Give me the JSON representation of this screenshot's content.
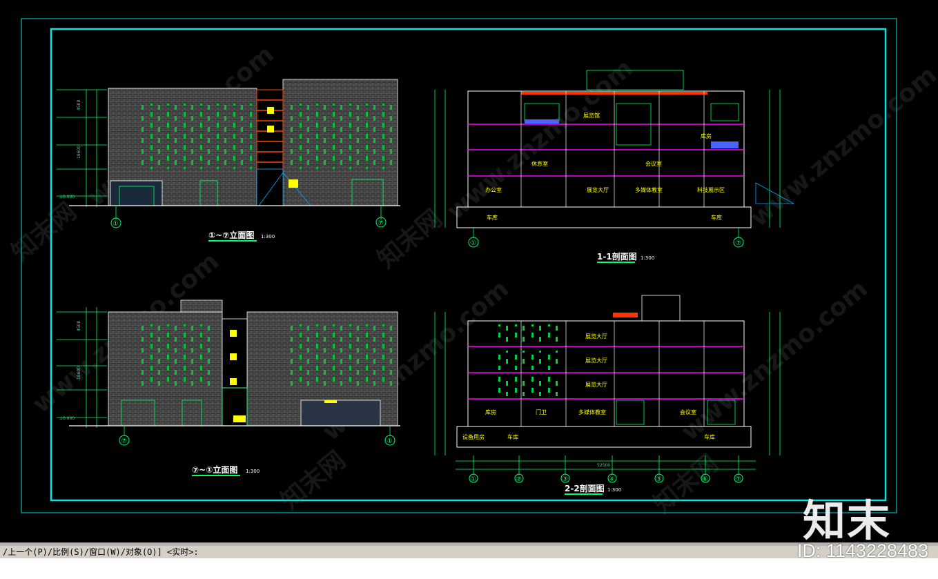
{
  "drawing": {
    "views": [
      {
        "title": "①~⑦立面图",
        "scale": "1:300"
      },
      {
        "title": "1-1剖面图",
        "scale": "1:300"
      },
      {
        "title": "⑦~①立面图",
        "scale": "1:300"
      },
      {
        "title": "2-2剖面图",
        "scale": "1:300"
      }
    ],
    "grid_labels": [
      "①",
      "⑦",
      "②",
      "③",
      "④",
      "⑤",
      "⑥"
    ],
    "room_labels": [
      "展览馆",
      "办公室",
      "车库",
      "展览大厅",
      "多媒体教室",
      "休息室",
      "会议室",
      "科技展示区",
      "库房",
      "门卫",
      "设备用房"
    ],
    "level_labels": [
      "±0.000",
      "-4.500",
      "5.100",
      "9.600",
      "14.100",
      "18.600",
      "23.100"
    ],
    "dimension_labels": [
      "4500",
      "5100",
      "4200",
      "18600",
      "52500"
    ],
    "colors": {
      "frame": "#00e5e5",
      "dim": "#00ff66",
      "text": "#ffff00",
      "slab": "#ff00ff",
      "wall": "#ffffff"
    }
  },
  "command_line": {
    "prompt": "/上一个(P)/比例(S)/窗口(W)/对象(O)] <实时>:"
  },
  "watermark": {
    "logo": "知末",
    "id": "ID: 1143228483",
    "site": "www.znzmo.com",
    "brand": "知末网"
  }
}
